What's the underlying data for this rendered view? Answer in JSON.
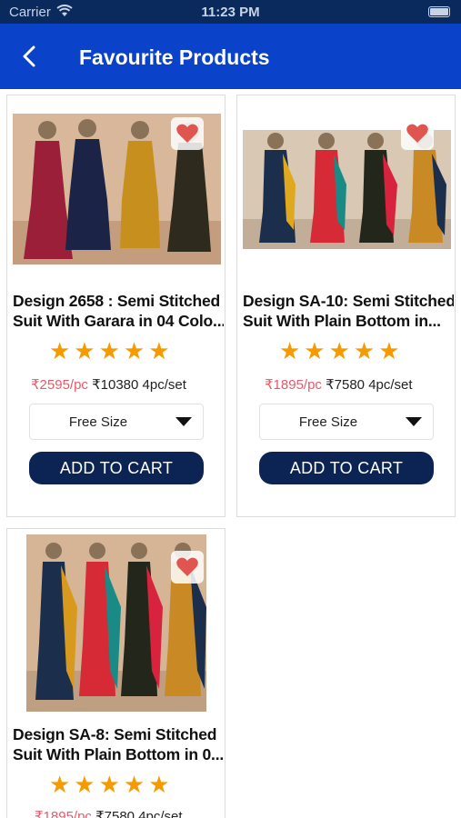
{
  "status_bar": {
    "carrier": "Carrier",
    "time": "11:23 PM"
  },
  "nav": {
    "title": "Favourite Products"
  },
  "products": [
    {
      "name_line1": "Design 2658 : Semi Stitched",
      "name_line2": "Suit With Garara in 04 Colo...",
      "rating": 5,
      "sale_price": "₹2595/pc",
      "set_price": "₹10380 4pc/set",
      "size": "Free Size",
      "cart_label": "ADD TO CART",
      "favourite": true
    },
    {
      "name_line1": "Design SA-10: Semi Stitched",
      "name_line2": "Suit With Plain Bottom  in...",
      "rating": 5,
      "sale_price": "₹1895/pc",
      "set_price": "₹7580 4pc/set",
      "size": "Free Size",
      "cart_label": "ADD TO CART",
      "favourite": true
    },
    {
      "name_line1": "Design SA-8: Semi Stitched",
      "name_line2": "Suit With Plain Bottom in 0...",
      "rating": 5,
      "sale_price": "₹1895/pc",
      "set_price": "₹7580 4pc/set",
      "favourite": true
    }
  ],
  "colors": {
    "nav": "#0a43c9",
    "status_bar": "#0a2a5e",
    "cart_button": "#0c2454",
    "star": "#f59b00",
    "sale_price": "#e85a6a",
    "heart": "#e0554f"
  }
}
